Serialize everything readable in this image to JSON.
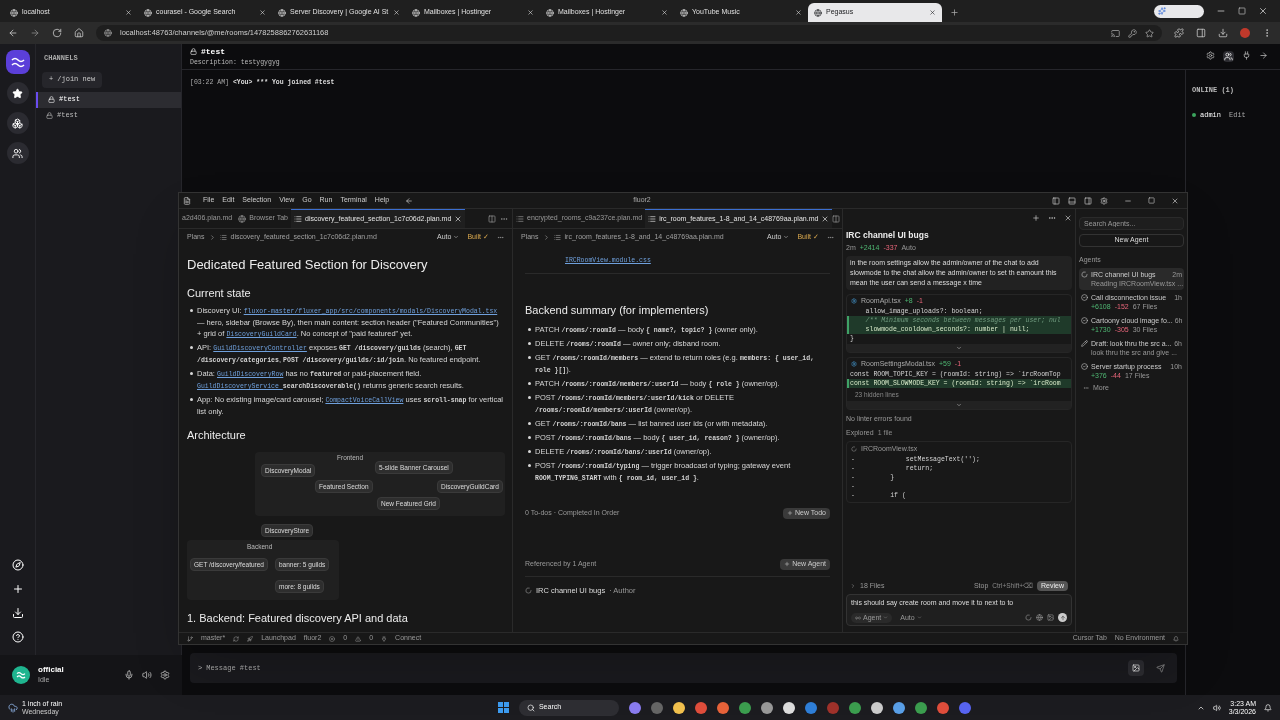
{
  "browser": {
    "tabs": [
      {
        "title": "localhost",
        "selected": false
      },
      {
        "title": "courasel - Google Search",
        "selected": false
      },
      {
        "title": "Server Discovery | Google AI St",
        "selected": false
      },
      {
        "title": "Mailboxes | Hostinger",
        "selected": false
      },
      {
        "title": "Mailboxes | Hostinger",
        "selected": false
      },
      {
        "title": "YouTube Music",
        "selected": false
      },
      {
        "title": "Pegasus",
        "selected": true
      }
    ],
    "url": "localhost:48763/channels/@me/rooms/1478258862762631168"
  },
  "app": {
    "channels_header": "CHANNELS",
    "join_button": "+ /join new",
    "channels": [
      {
        "name": "#test",
        "selected": true
      },
      {
        "name": "#test",
        "selected": false
      }
    ],
    "room": {
      "title": "#test",
      "description": "Description: testygygyg",
      "messages": [
        {
          "time": "[03:22 AM]",
          "author": "<You>",
          "text": "*** You joined #test"
        }
      ]
    },
    "online_header": "ONLINE (1)",
    "members": [
      {
        "name": "admin",
        "action": "Edit"
      }
    ],
    "user": {
      "name": "official",
      "status": "Idle"
    },
    "composer": {
      "prompt": ">",
      "placeholder": "Message #test"
    }
  },
  "ide": {
    "menu": [
      "File",
      "Edit",
      "Selection",
      "View",
      "Go",
      "Run",
      "Terminal",
      "Help"
    ],
    "title": "fluor2",
    "left_pane": {
      "tabs": [
        {
          "title": "a2d406.plan.md",
          "kind": "file",
          "selected": false
        },
        {
          "title": "Browser Tab",
          "kind": "browser",
          "selected": false
        },
        {
          "title": "discovery_featured_section_1c7c06d2.plan.md",
          "kind": "plan",
          "selected": true
        }
      ],
      "breadcrumb": [
        "Plans",
        "discovery_featured_section_1c7c06d2.plan.md"
      ],
      "mode": "Auto",
      "status": "Built ✓",
      "title": "Dedicated Featured Section for Discovery",
      "section_1": "Current state",
      "bullets": [
        [
          {
            "kind": "t",
            "s": "Discovery UI: "
          },
          {
            "kind": "l",
            "s": "fluxor-master/fluxer_app/src/components/modals/DiscoveryModal.tsx"
          },
          {
            "kind": "t",
            "s": " — hero, sidebar (Browse By), then main content: section header (\"Featured Communities\") + grid of "
          },
          {
            "kind": "l",
            "s": "DiscoveryGuildCard"
          },
          {
            "kind": "t",
            "s": ". No concept of \"paid featured\" yet."
          }
        ],
        [
          {
            "kind": "t",
            "s": "API: "
          },
          {
            "kind": "l",
            "s": "GuildDiscoveryController"
          },
          {
            "kind": "t",
            "s": " exposes "
          },
          {
            "kind": "c",
            "s": "GET /discovery/guilds"
          },
          {
            "kind": "t",
            "s": " (search), "
          },
          {
            "kind": "c",
            "s": "GET /discovery/categories"
          },
          {
            "kind": "t",
            "s": ", "
          },
          {
            "kind": "c",
            "s": "POST /discovery/guilds/:id/join"
          },
          {
            "kind": "t",
            "s": ". No featured endpoint."
          }
        ],
        [
          {
            "kind": "t",
            "s": "Data: "
          },
          {
            "kind": "l",
            "s": "GuildDiscoveryRow"
          },
          {
            "kind": "t",
            "s": " has no "
          },
          {
            "kind": "c",
            "s": "featured"
          },
          {
            "kind": "t",
            "s": " or paid-placement field. "
          },
          {
            "kind": "l",
            "s": "GuildDiscoveryService "
          },
          {
            "kind": "c",
            "s": "searchDiscoverable()"
          },
          {
            "kind": "t",
            "s": " returns generic search results."
          }
        ],
        [
          {
            "kind": "t",
            "s": "App: No existing image/card carousel; "
          },
          {
            "kind": "l",
            "s": "CompactVoiceCallView"
          },
          {
            "kind": "t",
            "s": " uses "
          },
          {
            "kind": "c",
            "s": "scroll-snap"
          },
          {
            "kind": "t",
            "s": " for vertical list only."
          }
        ]
      ],
      "section_2": "Architecture",
      "diagram": {
        "groups": [
          {
            "label": "Frontend"
          },
          {
            "label": "Backend"
          }
        ],
        "nodes": [
          "DiscoveryModal",
          "Featured Section",
          "5-slide Banner Carousel",
          "New Featured Grid",
          "DiscoveryGuildCard",
          "DiscoveryStore",
          "GET /discovery/featured",
          "banner: 5 guilds",
          "more: 8 guilds"
        ]
      },
      "section_3": "1. Backend: Featured discovery API and data"
    },
    "middle_pane": {
      "tabs": [
        {
          "title": "encrypted_rooms_c9a237ce.plan.md",
          "kind": "plan",
          "selected": false
        },
        {
          "title": "irc_room_features_1-8_and_14_c48769aa.plan.md",
          "kind": "plan",
          "selected": true
        }
      ],
      "breadcrumb": [
        "Plans",
        "irc_room_features_1-8_and_14_c48769aa.plan.md"
      ],
      "mode": "Auto",
      "status": "Built ✓",
      "top_link": "IRCRoomView.module.css",
      "heading": "Backend summary (for implementers)",
      "bullets": [
        [
          {
            "kind": "t",
            "s": "PATCH "
          },
          {
            "kind": "c",
            "s": "/rooms/:roomId"
          },
          {
            "kind": "t",
            "s": " — body "
          },
          {
            "kind": "c",
            "s": "{ name?, topic? }"
          },
          {
            "kind": "t",
            "s": " (owner only)."
          }
        ],
        [
          {
            "kind": "t",
            "s": "DELETE "
          },
          {
            "kind": "c",
            "s": "/rooms/:roomId"
          },
          {
            "kind": "t",
            "s": " — owner only; disband room."
          }
        ],
        [
          {
            "kind": "t",
            "s": "GET "
          },
          {
            "kind": "c",
            "s": "/rooms/:roomId/members"
          },
          {
            "kind": "t",
            "s": " — extend to return roles (e.g. "
          },
          {
            "kind": "c",
            "s": "members: { user_id, role }[]"
          },
          {
            "kind": "t",
            "s": ")."
          }
        ],
        [
          {
            "kind": "t",
            "s": "PATCH "
          },
          {
            "kind": "c",
            "s": "/rooms/:roomId/members/:userId"
          },
          {
            "kind": "t",
            "s": " — body "
          },
          {
            "kind": "c",
            "s": "{ role }"
          },
          {
            "kind": "t",
            "s": " (owner/op)."
          }
        ],
        [
          {
            "kind": "t",
            "s": "POST "
          },
          {
            "kind": "c",
            "s": "/rooms/:roomId/members/:userId/kick"
          },
          {
            "kind": "t",
            "s": " or DELETE "
          },
          {
            "kind": "c",
            "s": "/rooms/:roomId/members/:userId"
          },
          {
            "kind": "t",
            "s": " (owner/op)."
          }
        ],
        [
          {
            "kind": "t",
            "s": "GET "
          },
          {
            "kind": "c",
            "s": "/rooms/:roomId/bans"
          },
          {
            "kind": "t",
            "s": " — list banned user ids (or with metadata)."
          }
        ],
        [
          {
            "kind": "t",
            "s": "POST "
          },
          {
            "kind": "c",
            "s": "/rooms/:roomId/bans"
          },
          {
            "kind": "t",
            "s": " — body "
          },
          {
            "kind": "c",
            "s": "{ user_id, reason? }"
          },
          {
            "kind": "t",
            "s": " (owner/op)."
          }
        ],
        [
          {
            "kind": "t",
            "s": "DELETE "
          },
          {
            "kind": "c",
            "s": "/rooms/:roomId/bans/:userId"
          },
          {
            "kind": "t",
            "s": " (owner/op)."
          }
        ],
        [
          {
            "kind": "t",
            "s": "POST "
          },
          {
            "kind": "c",
            "s": "/rooms/:roomId/typing"
          },
          {
            "kind": "t",
            "s": " — trigger broadcast of typing; gateway event "
          },
          {
            "kind": "c",
            "s": "ROOM_TYPING_START"
          },
          {
            "kind": "t",
            "s": " with "
          },
          {
            "kind": "c",
            "s": "{ room_id, user_id }"
          },
          {
            "kind": "t",
            "s": "."
          }
        ]
      ],
      "todos": "0 To-dos · Completed In Order",
      "new_todo": "New Todo",
      "referenced": "Referenced by 1 Agent",
      "new_agent": "New Agent",
      "agent_ref": {
        "name": "IRC channel UI bugs",
        "role": "· Author"
      }
    },
    "chat": {
      "title": "IRC channel UI bugs",
      "age": "2m",
      "added": "+2414",
      "removed": "-337",
      "mode": "Auto",
      "user_message": "in the room settings allow the admin/owner of the chat to add slowmode to the chat allow the admin/owner to set th eamount this mean the user can send a message x time",
      "diffs": [
        {
          "file": "RoomApi.tsx",
          "added": "+8",
          "removed": "-1",
          "lines": [
            {
              "kind": "context",
              "text": "    allow_image_uploads?: boolean;"
            },
            {
              "kind": "comment",
              "text": "    /** Minimum seconds between messages per user; nul"
            },
            {
              "kind": "added",
              "text": "    slowmode_cooldown_seconds?: number | null;"
            },
            {
              "kind": "context",
              "text": "}"
            }
          ]
        },
        {
          "file": "RoomSettingsModal.tsx",
          "added": "+59",
          "removed": "-1",
          "lines": [
            {
              "kind": "context",
              "text": "const ROOM_TOPIC_KEY = (roomId: string) => `ircRoomTop"
            },
            {
              "kind": "added",
              "text": "const ROOM_SLOWMODE_KEY = (roomId: string) => `ircRoom"
            }
          ],
          "hidden": "23 hidden lines"
        }
      ],
      "linter": "No linter errors found",
      "explored": "Explored",
      "explored_count": "1 file",
      "explored_file": {
        "name": "IRCRoomView.tsx",
        "lines": [
          {
            "gutter": "-",
            "text": "            setMessageText('');"
          },
          {
            "gutter": "-",
            "text": "            return;"
          },
          {
            "gutter": "-",
            "text": "        }"
          },
          {
            "gutter": "-"
          },
          {
            "gutter": "-",
            "text": "        if ("
          }
        ]
      },
      "files": "18 Files",
      "stop": "Stop",
      "stop_shortcut": "Ctrl+Shift+⌫",
      "review": "Review",
      "input": "this should say create room and move it to next to to",
      "agent_mode": "Agent",
      "model": "Auto"
    },
    "agents": {
      "search_placeholder": "Search Agents...",
      "new_agent": "New Agent",
      "header": "Agents",
      "items": [
        {
          "kind": "running",
          "title": "IRC channel UI bugs",
          "sub": "Reading IRCRoomView.tsx ...",
          "time": "2m",
          "selected": true
        },
        {
          "kind": "done",
          "title": "Call disconnection issue",
          "added": "+6108",
          "removed": "-152",
          "files": "67 Files",
          "time": "1h",
          "selected": false
        },
        {
          "kind": "done",
          "title": "Cartoony cloud image fo...",
          "added": "+1730",
          "removed": "-305",
          "files": "30 Files",
          "time": "6h",
          "selected": false
        },
        {
          "kind": "draft",
          "title": "Draft: look thru the src a...",
          "sub": "look thru the src and give ...",
          "time": "6h",
          "selected": false
        },
        {
          "kind": "done",
          "title": "Server startup process",
          "added": "+376",
          "removed": "-44",
          "files": "17 Files",
          "time": "10h",
          "selected": false
        }
      ],
      "more": "More"
    },
    "status_bar": {
      "branch": "master*",
      "launchpad": "Launchpad",
      "project": "fluor2",
      "errors": "0",
      "warnings": "0",
      "connect": "Connect",
      "cursor_tab": "Cursor Tab",
      "environment": "No Environment"
    }
  },
  "taskbar": {
    "weather": "1 inch of rain",
    "day": "Wednesday",
    "search": "Search",
    "time": "3:23 AM",
    "date": "3/3/2026"
  }
}
